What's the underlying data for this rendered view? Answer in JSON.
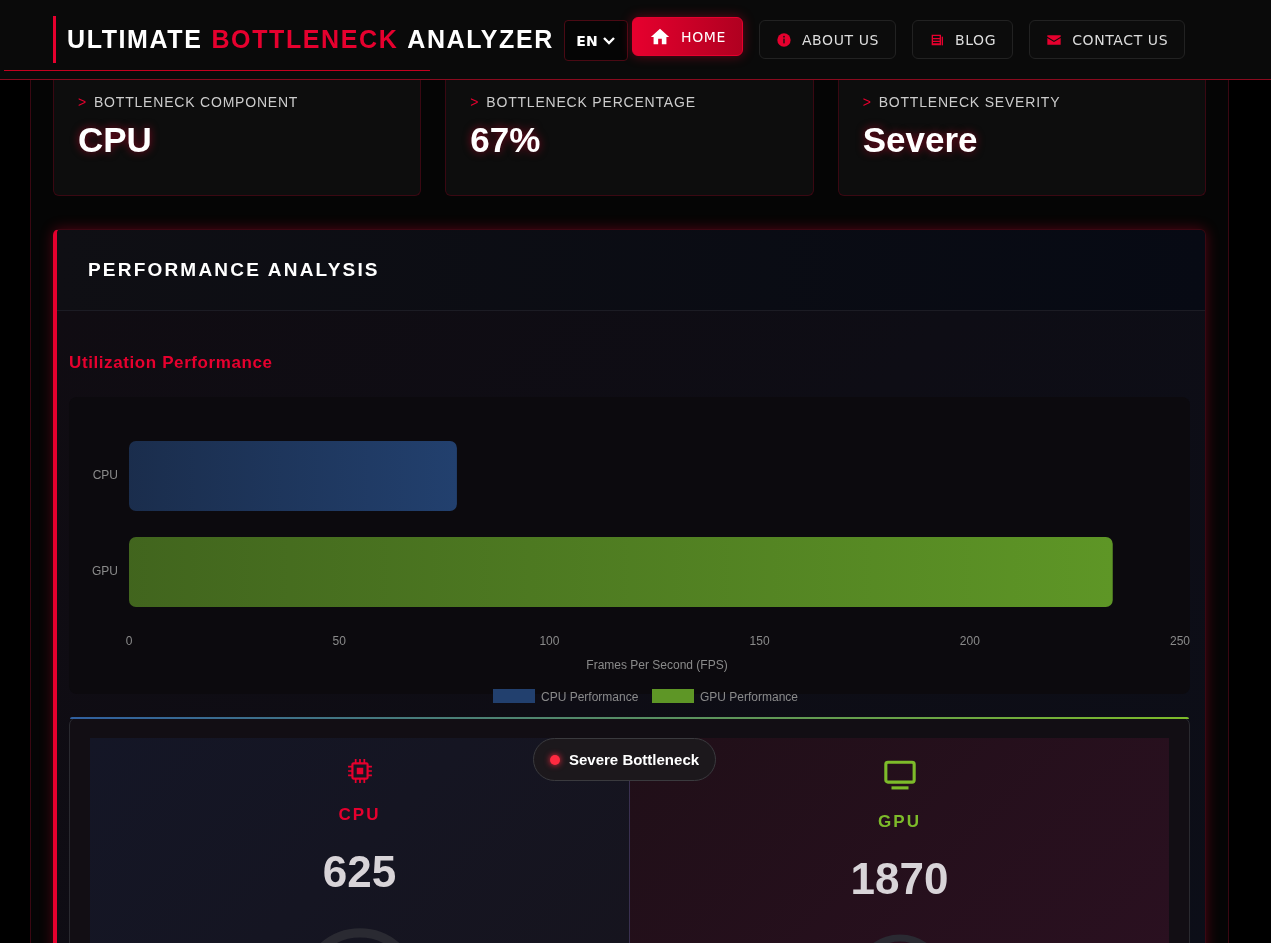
{
  "header": {
    "logo": [
      {
        "text": "ULTIMATE",
        "accent": false
      },
      {
        "text": "BOTTLENECK",
        "accent": true
      },
      {
        "text": "ANALYZER",
        "accent": false
      }
    ],
    "language": "EN",
    "nav": [
      {
        "label": "HOME",
        "kind": "home",
        "selected": true
      },
      {
        "label": "ABOUT US",
        "kind": "info",
        "selected": false
      },
      {
        "label": "BLOG",
        "kind": "news",
        "selected": false
      },
      {
        "label": "CONTACT US",
        "kind": "mail",
        "selected": false
      }
    ]
  },
  "stats": [
    {
      "marker": ">",
      "label": "BOTTLENECK COMPONENT",
      "value": "CPU"
    },
    {
      "marker": ">",
      "label": "BOTTLENECK PERCENTAGE",
      "value": "67%"
    },
    {
      "marker": ">",
      "label": "BOTTLENECK SEVERITY",
      "value": "Severe"
    }
  ],
  "panel": {
    "title": "PERFORMANCE ANALYSIS",
    "section_title": "Utilization Performance",
    "chart_data": {
      "type": "bar",
      "orientation": "horizontal",
      "xlabel": "Frames Per Second (FPS)",
      "categories": [
        "CPU",
        "GPU"
      ],
      "series": [
        {
          "name": "CPU Performance",
          "color": "#22406e",
          "values": [
            78,
            null
          ]
        },
        {
          "name": "GPU Performance",
          "color": "#5e9626",
          "values": [
            null,
            234
          ]
        }
      ],
      "xlim": [
        0,
        250
      ],
      "xticks": [
        0,
        50,
        100,
        150,
        200,
        250
      ],
      "legend": "bottom"
    },
    "comparison": {
      "badge": "Severe Bottleneck",
      "items": [
        {
          "kind": "cpu",
          "name": "CPU",
          "value": "625",
          "color": "#e6002e"
        },
        {
          "kind": "gpu",
          "name": "GPU",
          "value": "1870",
          "color": "#7dbb2a"
        }
      ]
    }
  }
}
